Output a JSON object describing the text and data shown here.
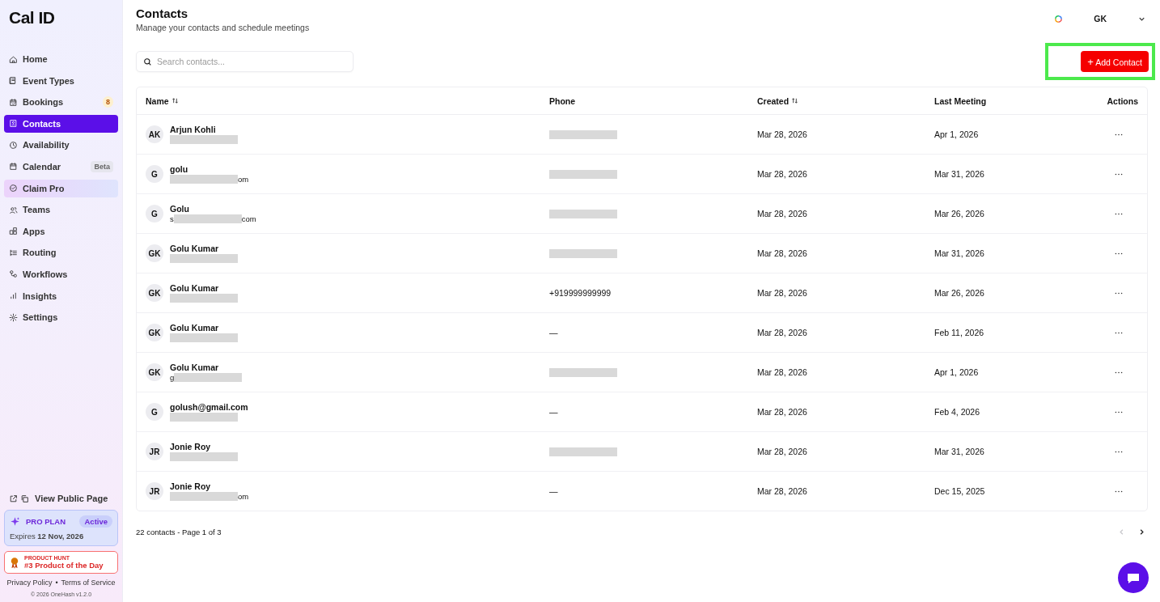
{
  "sidebar": {
    "logo": "Cal ID",
    "items": [
      {
        "label": "Home",
        "selected": false,
        "kind": "nav"
      },
      {
        "label": "Event Types",
        "selected": false,
        "kind": "nav"
      },
      {
        "label": "Bookings",
        "selected": false,
        "kind": "nav",
        "badge": {
          "text": "8",
          "kind": "count"
        }
      },
      {
        "label": "Contacts",
        "selected": true,
        "kind": "nav"
      },
      {
        "label": "Availability",
        "selected": false,
        "kind": "nav"
      },
      {
        "label": "Calendar",
        "selected": false,
        "kind": "nav",
        "badge": {
          "text": "Beta",
          "kind": "tag"
        }
      },
      {
        "label": "Claim Pro",
        "selected": false,
        "kind": "promo"
      },
      {
        "label": "Teams",
        "selected": false,
        "kind": "nav"
      },
      {
        "label": "Apps",
        "selected": false,
        "kind": "nav"
      },
      {
        "label": "Routing",
        "selected": false,
        "kind": "nav"
      },
      {
        "label": "Workflows",
        "selected": false,
        "kind": "nav"
      },
      {
        "label": "Insights",
        "selected": false,
        "kind": "nav"
      },
      {
        "label": "Settings",
        "selected": false,
        "kind": "nav"
      }
    ],
    "public_page": "View Public Page",
    "plan": {
      "name": "PRO PLAN",
      "status": "Active",
      "expiry": "Expires **12 Nov, 2026**"
    },
    "product_hunt": {
      "eyebrow": "PRODUCT HUNT",
      "title": "#3 Product of the Day"
    },
    "footer_links": [
      "Privacy Policy",
      "Terms of Service"
    ],
    "separator": "•",
    "copyright": "© 2026 OneHash v1.2.0"
  },
  "header": {
    "title": "Contacts",
    "subtitle": "Manage your contacts and schedule meetings",
    "user": "GK"
  },
  "search": {
    "placeholder": "Search contacts..."
  },
  "add_button": {
    "label": "Add Contact",
    "icon": "+",
    "highlighted": true
  },
  "table": {
    "columns": [
      {
        "label": "Name",
        "sortable": true
      },
      {
        "label": "Phone",
        "sortable": false
      },
      {
        "label": "Created",
        "sortable": true
      },
      {
        "label": "Last Meeting",
        "sortable": false
      },
      {
        "label": "Actions",
        "sortable": false
      }
    ],
    "rows": [
      {
        "initials": "AK",
        "name": "Arjun Kohli",
        "phone": {
          "kind": "redacted"
        },
        "created": "Mar 28, 2026",
        "last_meeting": "Apr 1, 2026"
      },
      {
        "initials": "G",
        "name": "golu",
        "email_suffix": "om",
        "phone": {
          "kind": "redacted"
        },
        "created": "Mar 28, 2026",
        "last_meeting": "Mar 31, 2026"
      },
      {
        "initials": "G",
        "name": "Golu",
        "email_prefix": "s",
        "email_suffix": "com",
        "phone": {
          "kind": "redacted"
        },
        "created": "Mar 28, 2026",
        "last_meeting": "Mar 26, 2026"
      },
      {
        "initials": "GK",
        "name": "Golu Kumar",
        "phone": {
          "kind": "redacted"
        },
        "created": "Mar 28, 2026",
        "last_meeting": "Mar 31, 2026"
      },
      {
        "initials": "GK",
        "name": "Golu Kumar",
        "phone": {
          "kind": "text",
          "text": "+919999999999"
        },
        "created": "Mar 28, 2026",
        "last_meeting": "Mar 26, 2026"
      },
      {
        "initials": "GK",
        "name": "Golu Kumar",
        "phone": {
          "kind": "text",
          "text": "—"
        },
        "created": "Mar 28, 2026",
        "last_meeting": "Feb 11, 2026"
      },
      {
        "initials": "GK",
        "name": "Golu Kumar",
        "email_prefix": "g",
        "phone": {
          "kind": "redacted"
        },
        "created": "Mar 28, 2026",
        "last_meeting": "Apr 1, 2026"
      },
      {
        "initials": "G",
        "name": "golush@gmail.com",
        "phone": {
          "kind": "text",
          "text": "—"
        },
        "created": "Mar 28, 2026",
        "last_meeting": "Feb 4, 2026"
      },
      {
        "initials": "JR",
        "name": "Jonie Roy",
        "phone": {
          "kind": "redacted"
        },
        "created": "Mar 28, 2026",
        "last_meeting": "Mar 31, 2026"
      },
      {
        "initials": "JR",
        "name": "Jonie Roy",
        "email_suffix": "om",
        "phone": {
          "kind": "text",
          "text": "—"
        },
        "created": "Mar 28, 2026",
        "last_meeting": "Dec 15, 2025"
      }
    ]
  },
  "pagination": {
    "summary": "22 contacts - Page 1 of 3",
    "prev_disabled": true,
    "next_disabled": false
  }
}
